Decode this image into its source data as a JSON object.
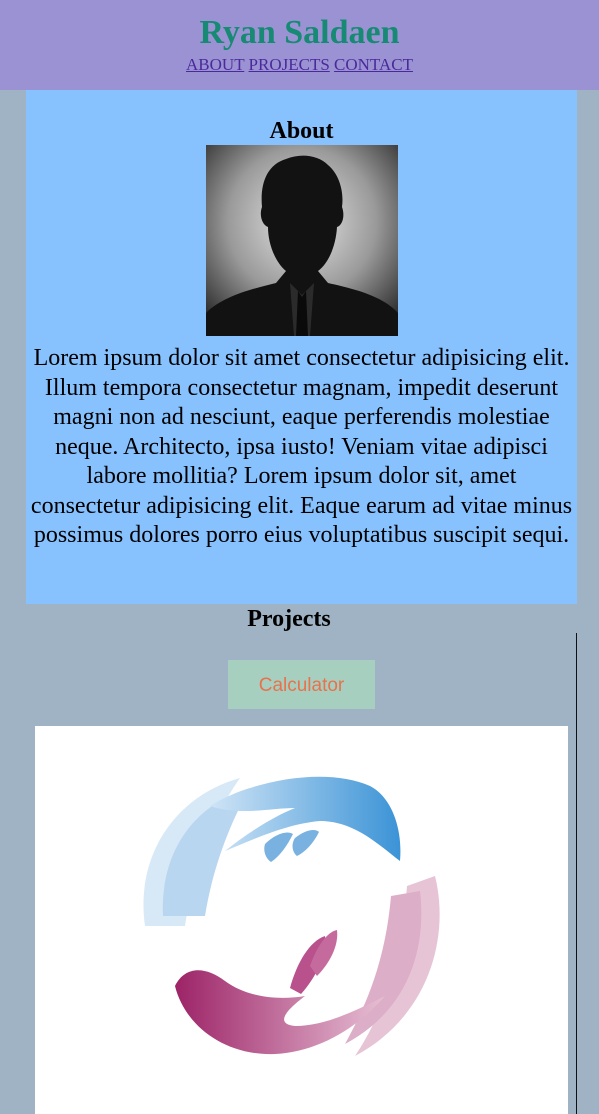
{
  "header": {
    "title": "Ryan Saldaen",
    "nav": [
      "ABOUT",
      "PROJECTS",
      "CONTACT"
    ]
  },
  "about": {
    "heading": "About",
    "paragraph": "Lorem ipsum dolor sit amet consectetur adipisicing elit. Illum tempora consectetur magnam, impedit deserunt magni non ad nesciunt, eaque perferendis molestiae neque. Architecto, ipsa iusto! Veniam vitae adipisci labore mollitia? Lorem ipsum dolor sit, amet consectetur adipisicing elit. Eaque earum ad vitae minus possimus dolores porro eius voluptatibus suscipit sequi."
  },
  "projects": {
    "heading": "Projects",
    "button_label": "Calculator"
  },
  "colors": {
    "header_bg": "#9b92d4",
    "title": "#178a74",
    "about_bg": "#88c2fe",
    "page_bg": "#9fb3c5",
    "button_bg": "#a7cfc0",
    "button_text": "#e8724c"
  }
}
